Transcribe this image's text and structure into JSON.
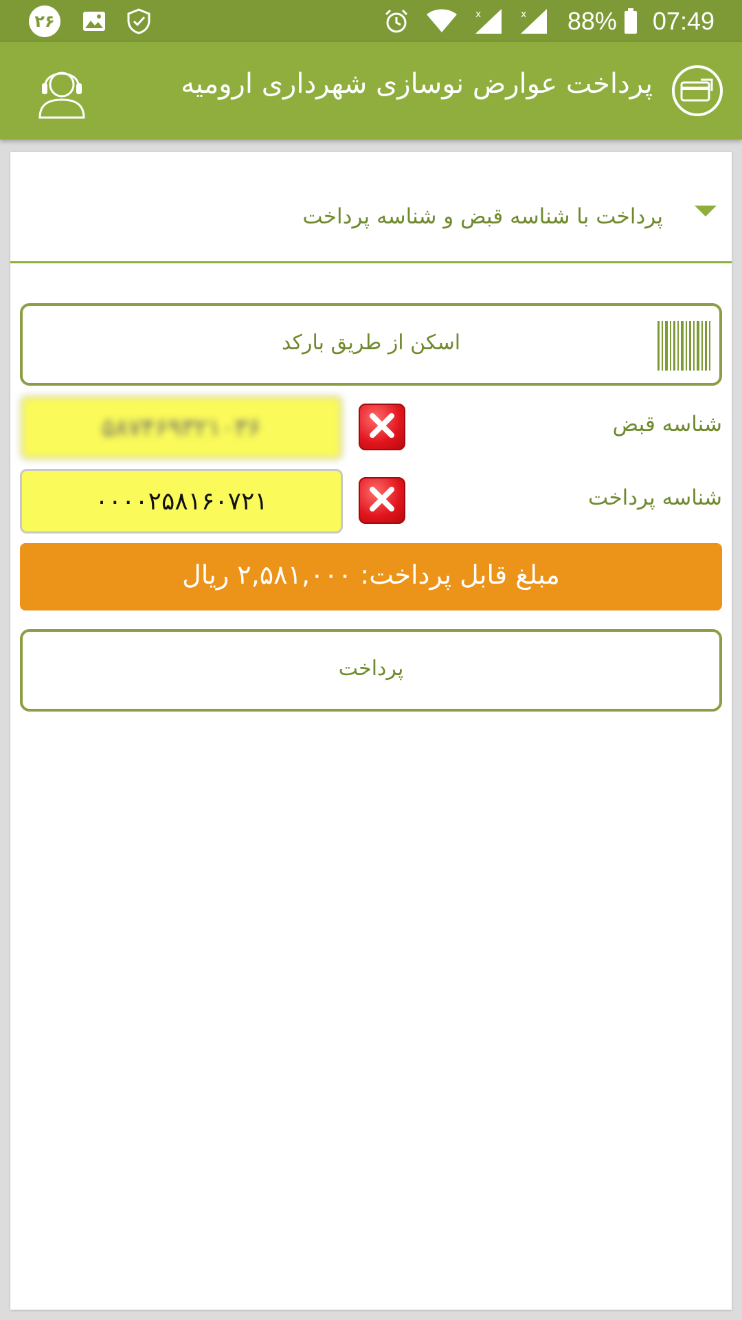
{
  "status_bar": {
    "notification_count": "۲۶",
    "icons": [
      "image-icon",
      "shield-icon",
      "alarm-icon",
      "wifi-icon",
      "signal-icon",
      "battery-icon"
    ],
    "battery": "88%",
    "time": "07:49"
  },
  "app_bar": {
    "title": "پرداخت عوارض نوسازی شهرداری ارومیه",
    "support_icon": "headset-user-icon",
    "logo_icon": "card-payment-icon"
  },
  "section": {
    "title": "پرداخت با شناسه قبض و شناسه پرداخت"
  },
  "scan": {
    "label": "اسکن از طریق بارکد",
    "icon": "barcode-icon"
  },
  "bill_field": {
    "label": "شناسه قبض",
    "value": "۵۸۷۴۶۹۳۲۱۰۳۶"
  },
  "payment_field": {
    "label": "شناسه پرداخت",
    "value": "۰۰۰۰۲۵۸۱۶۰۷۲۱"
  },
  "amount": {
    "text": "مبلغ قابل پرداخت: ۲,۵۸۱,۰۰۰ ریال"
  },
  "pay_button": {
    "label": "پرداخت"
  },
  "colors": {
    "primary": "#8fae3e",
    "status_bar": "#7e9a36",
    "accent_orange": "#ec9319",
    "input_yellow": "#fafa5a",
    "text_green": "#6f8a2d"
  }
}
